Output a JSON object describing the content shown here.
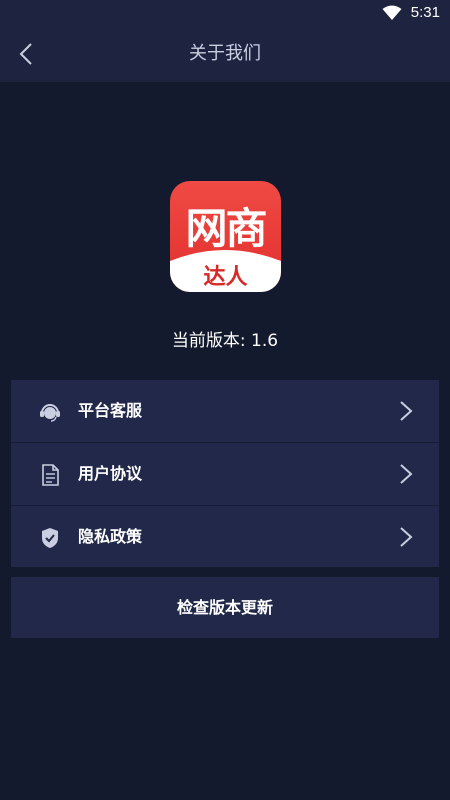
{
  "status_bar": {
    "time": "5:31",
    "wifi_icon": "wifi-icon"
  },
  "nav": {
    "title": "关于我们",
    "back_icon": "chevron-left-icon"
  },
  "app": {
    "logo_main": "网商",
    "logo_sub": "达人",
    "logo_color": "#e83a36",
    "version_text": "当前版本: 1.6"
  },
  "menu": {
    "items": [
      {
        "label": "平台客服",
        "icon": "headset-icon"
      },
      {
        "label": "用户协议",
        "icon": "document-icon"
      },
      {
        "label": "隐私政策",
        "icon": "shield-check-icon"
      }
    ]
  },
  "update_button": {
    "label": "检查版本更新"
  },
  "colors": {
    "background": "#141a2e",
    "header": "#1e2440",
    "card": "#222849"
  }
}
